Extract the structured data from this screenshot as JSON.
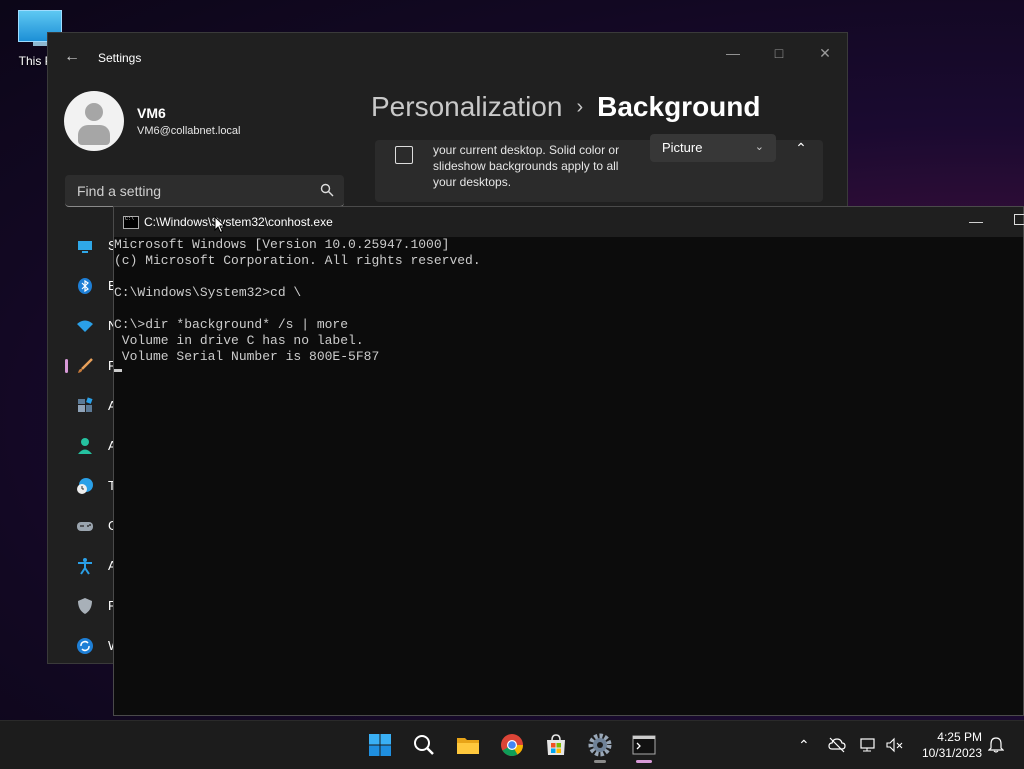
{
  "desktop": {
    "icon_label": "This PC"
  },
  "settings": {
    "title": "Settings",
    "user": {
      "name": "VM6",
      "email": "VM6@collabnet.local"
    },
    "search": {
      "placeholder": "Find a setting"
    },
    "nav": [
      {
        "label": "S",
        "icon": "system-icon"
      },
      {
        "label": "B",
        "icon": "bluetooth-icon"
      },
      {
        "label": "N",
        "icon": "wifi-icon"
      },
      {
        "label": "P",
        "icon": "brush-icon",
        "active": true
      },
      {
        "label": "A",
        "icon": "apps-icon"
      },
      {
        "label": "A",
        "icon": "accounts-icon"
      },
      {
        "label": "T",
        "icon": "time-language-icon"
      },
      {
        "label": "G",
        "icon": "gamepad-icon"
      },
      {
        "label": "A",
        "icon": "accessibility-icon"
      },
      {
        "label": "P",
        "icon": "shield-icon"
      },
      {
        "label": "W",
        "icon": "update-icon"
      }
    ],
    "breadcrumb": {
      "parent": "Personalization",
      "separator": "›",
      "current": "Background"
    },
    "background_card": {
      "description": "your current desktop. Solid color or slideshow backgrounds apply to all your desktops.",
      "dropdown_value": "Picture"
    }
  },
  "console": {
    "title": "C:\\Windows\\System32\\conhost.exe",
    "lines": [
      "Microsoft Windows [Version 10.0.25947.1000]",
      "(c) Microsoft Corporation. All rights reserved.",
      "",
      "C:\\Windows\\System32>cd \\",
      "",
      "C:\\>dir *background* /s | more",
      " Volume in drive C has no label.",
      " Volume Serial Number is 800E-5F87"
    ]
  },
  "taskbar": {
    "clock": {
      "time": "4:25 PM",
      "date": "10/31/2023"
    },
    "apps": [
      "start-icon",
      "search-icon",
      "file-explorer-icon",
      "chrome-icon",
      "store-icon",
      "settings-gear-icon",
      "terminal-icon"
    ]
  }
}
